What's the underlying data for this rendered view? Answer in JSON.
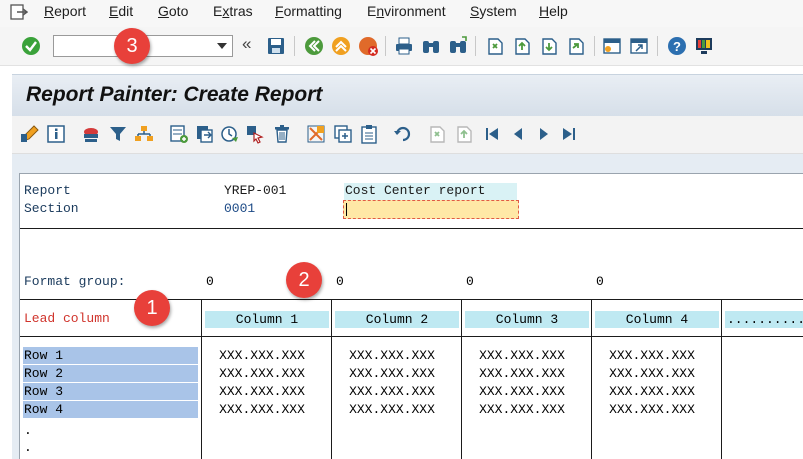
{
  "menu": {
    "items": [
      {
        "pre": "",
        "ul": "R",
        "post": "eport"
      },
      {
        "pre": "",
        "ul": "E",
        "post": "dit"
      },
      {
        "pre": "",
        "ul": "G",
        "post": "oto"
      },
      {
        "pre": "E",
        "ul": "x",
        "post": "tras"
      },
      {
        "pre": "",
        "ul": "F",
        "post": "ormatting"
      },
      {
        "pre": "E",
        "ul": "n",
        "post": "vironment"
      },
      {
        "pre": "",
        "ul": "S",
        "post": "ystem"
      },
      {
        "pre": "",
        "ul": "H",
        "post": "elp"
      }
    ]
  },
  "toolbar": {
    "command_value": "",
    "collapse_glyph": "«"
  },
  "title": "Report Painter: Create Report",
  "report": {
    "report_label": "Report",
    "report_id": "YREP-001",
    "report_desc": "Cost Center report",
    "section_label": "Section",
    "section_id": "0001",
    "section_desc": "",
    "format_group_label": "Format group:",
    "format_values": [
      "0",
      "0",
      "0",
      "0"
    ],
    "lead_column": "Lead column",
    "columns": [
      "Column 1",
      "Column 2",
      "Column 3",
      "Column 4",
      "..........."
    ],
    "rows": [
      "Row 1",
      "Row 2",
      "Row 3",
      "Row 4"
    ],
    "cell_value": "XXX.XXX.XXX",
    "dots": [
      ".",
      "."
    ]
  },
  "badges": [
    "1",
    "2",
    "3"
  ],
  "colors": {
    "badge": "#e8403a",
    "lead_column_text": "#d0342c",
    "row_label_bg": "#a9c4e8",
    "column_header_bg": "#bfe9f2",
    "section_field_bg": "#ffe8a6"
  }
}
